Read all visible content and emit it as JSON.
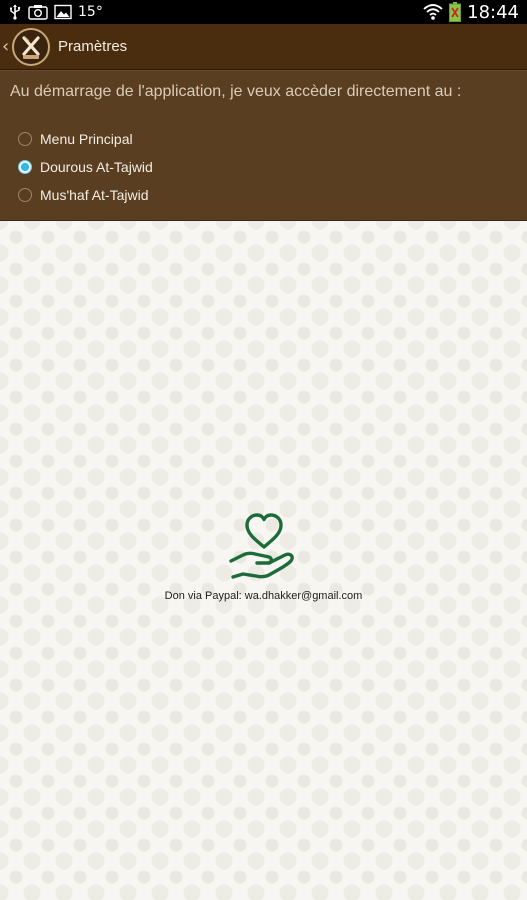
{
  "status_bar": {
    "temperature": "15°",
    "time": "18:44",
    "icons": [
      "usb-icon",
      "screenshot-icon",
      "image-icon",
      "wifi-icon",
      "battery-icon"
    ]
  },
  "action_bar": {
    "title": "Pramètres",
    "logo_icon": "app-logo-icon",
    "back_icon": "chevron-left-icon"
  },
  "settings": {
    "prompt": "Au démarrage de l'application, je veux accèder directement au :",
    "options": [
      {
        "label": "Menu Principal",
        "checked": false
      },
      {
        "label": "Dourous At-Tajwid",
        "checked": true
      },
      {
        "label": "Mus'haf At-Tajwid",
        "checked": false
      }
    ]
  },
  "donation": {
    "icon": "heart-in-hand-icon",
    "text": "Don via Paypal: wa.dhakker@gmail.com"
  },
  "colors": {
    "action_bar_bg": "#4a2c0f",
    "panel_bg": "#5a3e22",
    "radio_checked": "#36b6e5",
    "donation_icon": "#1d6b3a"
  }
}
